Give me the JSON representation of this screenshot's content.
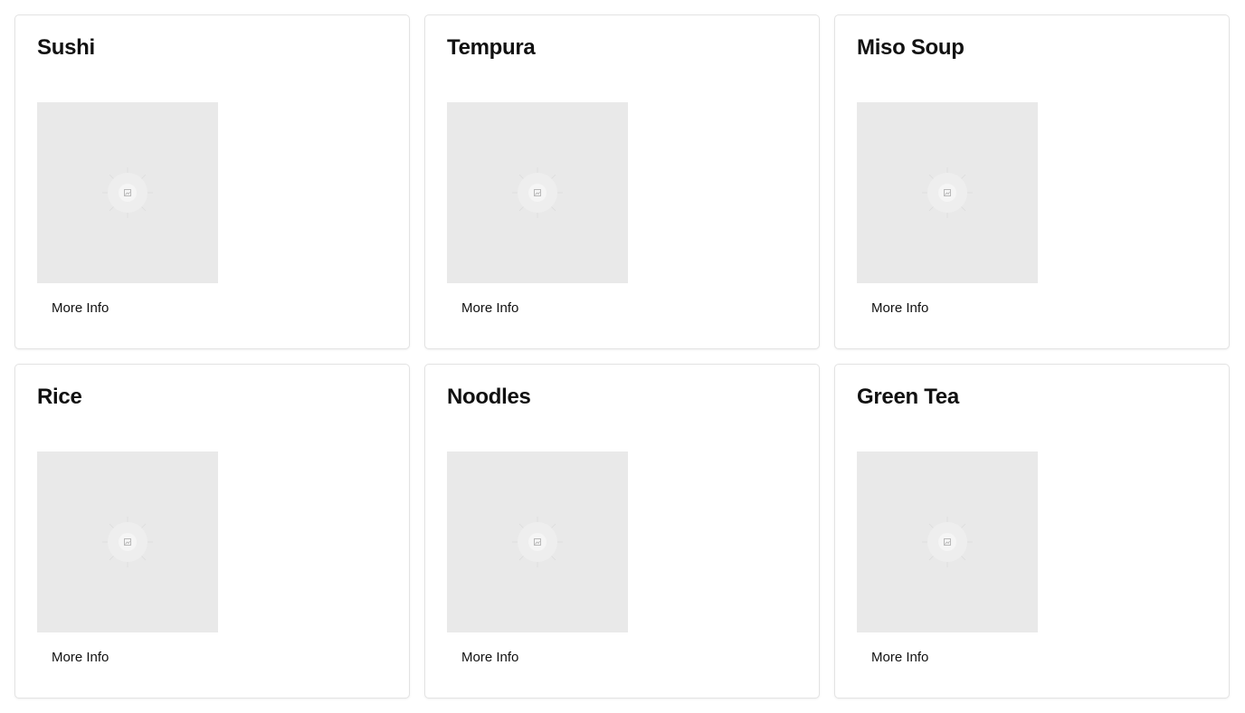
{
  "cards": [
    {
      "title": "Sushi",
      "button_label": "More Info",
      "image_icon": "image-placeholder-icon"
    },
    {
      "title": "Tempura",
      "button_label": "More Info",
      "image_icon": "image-placeholder-icon"
    },
    {
      "title": "Miso Soup",
      "button_label": "More Info",
      "image_icon": "image-placeholder-icon"
    },
    {
      "title": "Rice",
      "button_label": "More Info",
      "image_icon": "image-placeholder-icon"
    },
    {
      "title": "Noodles",
      "button_label": "More Info",
      "image_icon": "image-placeholder-icon"
    },
    {
      "title": "Green Tea",
      "button_label": "More Info",
      "image_icon": "image-placeholder-icon"
    }
  ],
  "colors": {
    "card_border": "#e3e3e3",
    "image_placeholder_bg": "#e9e9e9",
    "text": "#111111"
  }
}
